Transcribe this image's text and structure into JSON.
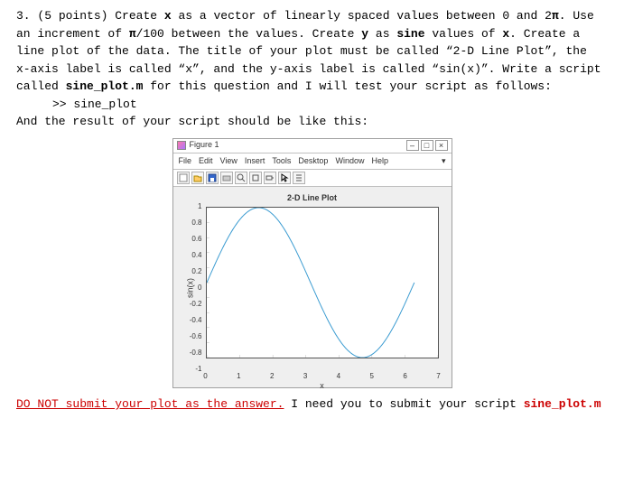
{
  "q": {
    "number": "3.",
    "points": "(5 points)",
    "t1": " Create ",
    "x": "x",
    "t2": " as a vector of linearly spaced values between 0 and 2",
    "pi1": "π",
    "t3": ". Use an increment of ",
    "pi2": "π",
    "t4": "/100 between the values. Create ",
    "y": "y",
    "t5": " as ",
    "sine": "sine",
    "t6": " values of ",
    "x2": "x",
    "t7": ". Create a line plot of the data. The title of your plot must be called “2-D Line Plot”, the x-axis label is called “x”, and the y-axis label is called “sin(x)”. Write a script called ",
    "script": "sine_plot.m",
    "t8": " for this question and I will test your script as follows:",
    "cmd": ">> sine_plot",
    "t9": "And the result of your script should be like this:"
  },
  "figure": {
    "window_title": "Figure 1",
    "menus": [
      "File",
      "Edit",
      "View",
      "Insert",
      "Tools",
      "Desktop",
      "Window",
      "Help"
    ],
    "controls": {
      "min": "–",
      "max": "□",
      "close": "×"
    },
    "chart_title": "2-D Line Plot",
    "xlabel": "x",
    "ylabel": "sin(x)"
  },
  "chart_data": {
    "type": "line",
    "title": "2-D Line Plot",
    "xlabel": "x",
    "ylabel": "sin(x)",
    "xlim": [
      0,
      7
    ],
    "ylim": [
      -1,
      1
    ],
    "xticks": [
      0,
      1,
      2,
      3,
      4,
      5,
      6,
      7
    ],
    "yticks": [
      -1,
      -0.8,
      -0.6,
      -0.4,
      -0.2,
      0,
      0.2,
      0.4,
      0.6,
      0.8,
      1
    ],
    "series": [
      {
        "name": "sin(x)",
        "x_range": [
          0,
          6.2832
        ],
        "values_desc": "y = sin(x), x from 0 to 2π step π/100"
      }
    ]
  },
  "footer": {
    "warn": "DO NOT submit your plot as the answer.",
    "tail1": " I need you to submit your script ",
    "script": "sine_plot.m"
  }
}
